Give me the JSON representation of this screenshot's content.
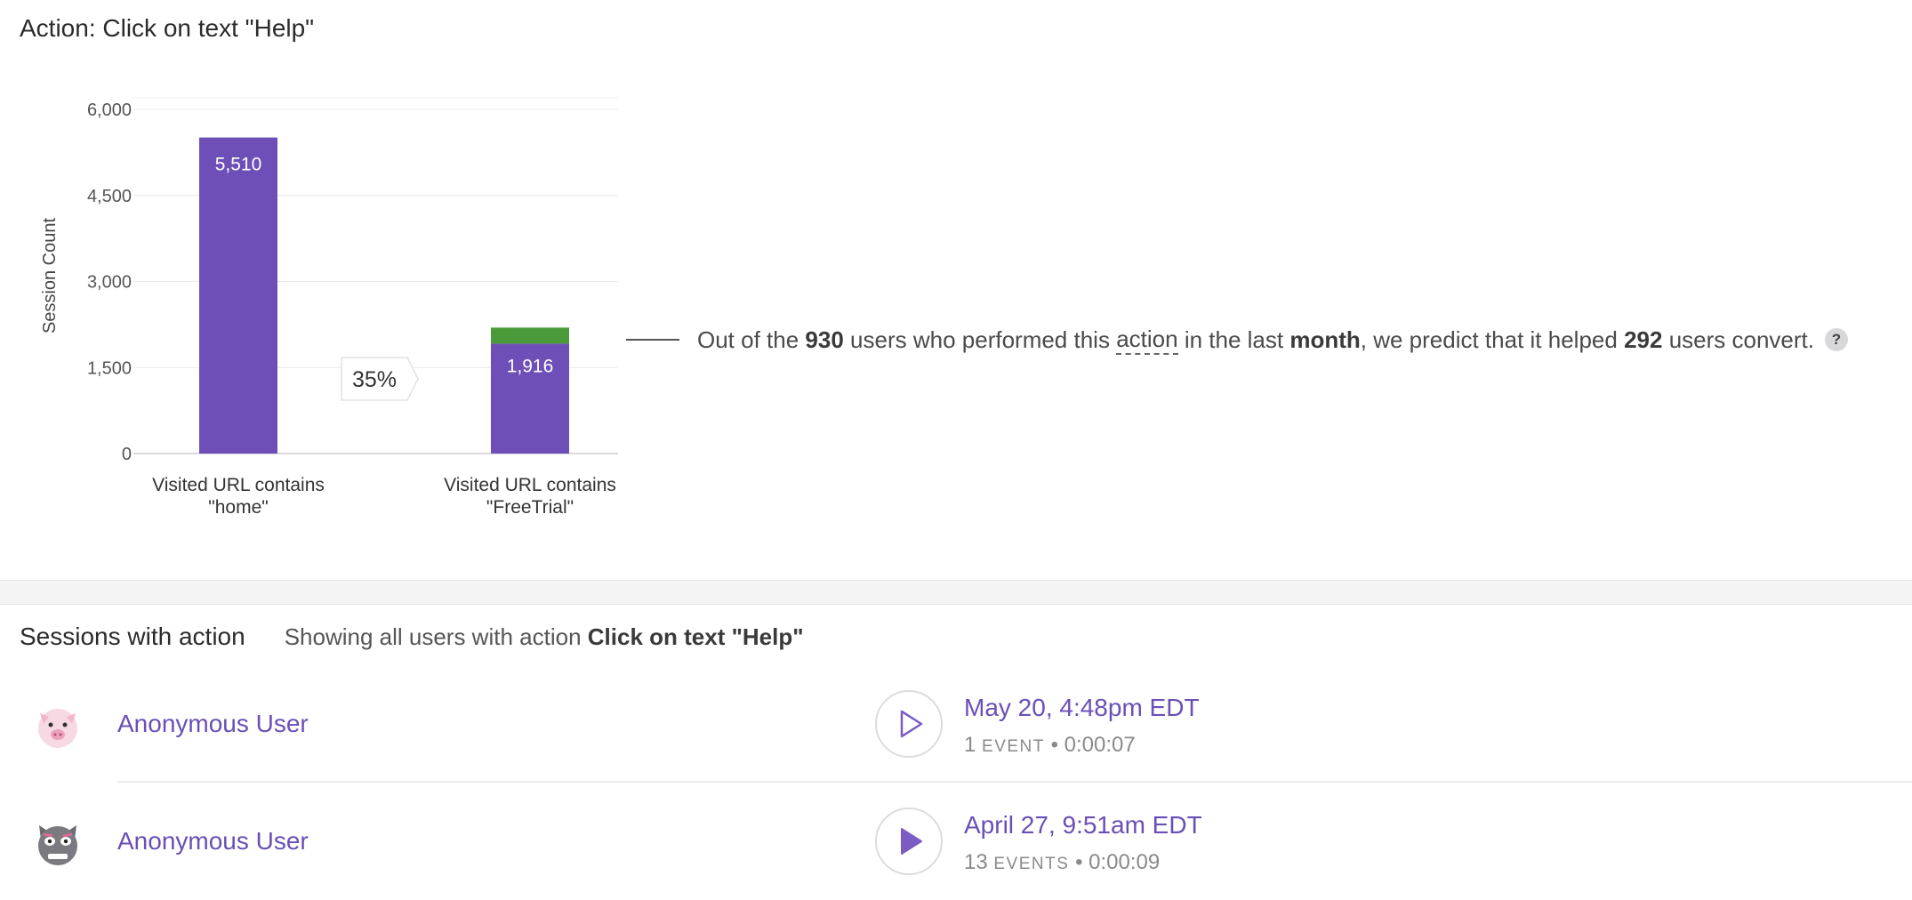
{
  "page": {
    "action_title": "Action: Click on text \"Help\""
  },
  "chart_data": {
    "type": "bar",
    "ylabel": "Session Count",
    "ylim": [
      0,
      6000
    ],
    "yticks": [
      "6,000",
      "4,500",
      "3,000",
      "1,500",
      "0"
    ],
    "ytick_values": [
      6000,
      4500,
      3000,
      1500,
      0
    ],
    "categories": [
      "Visited URL contains \"home\"",
      "Visited URL contains \"FreeTrial\""
    ],
    "category_lines": [
      [
        "Visited URL contains",
        "\"home\""
      ],
      [
        "Visited URL contains",
        "\"FreeTrial\""
      ]
    ],
    "series": [
      {
        "values": [
          5510,
          1916
        ],
        "labels": [
          "5,510",
          "1,916"
        ],
        "color": "#6e4fb7"
      },
      {
        "values": [
          0,
          280
        ],
        "color": "#4a9a3a"
      }
    ],
    "conversion_label": "35%",
    "grid": true
  },
  "insight": {
    "prefix": "Out of the",
    "users_count": "930",
    "mid1": "users who performed this",
    "action_word": "action",
    "mid2": "in the last",
    "period": "month",
    "mid3": ", we predict that it helped",
    "helped_count": "292",
    "suffix": "users convert.",
    "help_icon": "?"
  },
  "sessions": {
    "title": "Sessions with action",
    "subtitle_prefix": "Showing all users with action",
    "subtitle_action": "Click on text \"Help\"",
    "rows": [
      {
        "user": "Anonymous User",
        "avatar": "pig-avatar-icon",
        "time": "May 20, 4:48pm EDT",
        "event_count": "1",
        "event_unit": "EVENT",
        "duration": "0:00:07",
        "play_state": "outline"
      },
      {
        "user": "Anonymous User",
        "avatar": "cat-avatar-icon",
        "time": "April 27, 9:51am EDT",
        "event_count": "13",
        "event_unit": "EVENTS",
        "duration": "0:00:09",
        "play_state": "filled"
      }
    ]
  },
  "colors": {
    "accent": "#6e4fb7",
    "converted": "#4a9a3a",
    "link": "#6a4fb6"
  }
}
